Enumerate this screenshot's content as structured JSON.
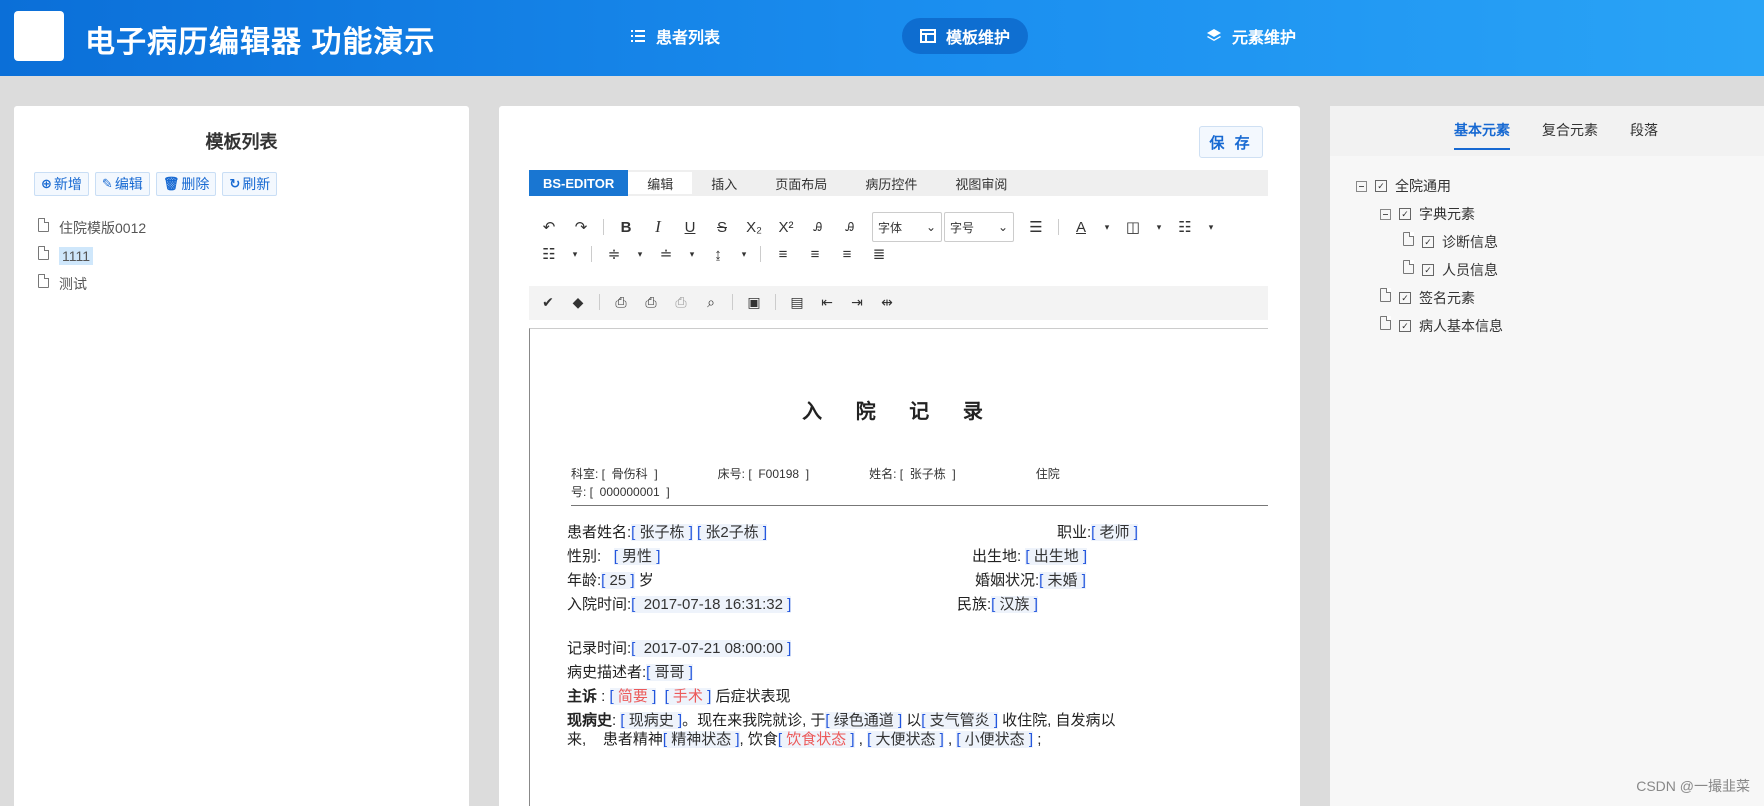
{
  "header": {
    "title": "电子病历编辑器 功能演示",
    "nav": [
      {
        "label": "患者列表",
        "icon": "list-icon"
      },
      {
        "label": "模板维护",
        "icon": "template-icon"
      },
      {
        "label": "元素维护",
        "icon": "layers-icon"
      }
    ]
  },
  "template_panel": {
    "title": "模板列表",
    "buttons": {
      "add": "新增",
      "edit": "编辑",
      "delete": "删除",
      "refresh": "刷新"
    },
    "items": [
      "住院模版0012",
      "1111",
      "测试"
    ]
  },
  "editor": {
    "save_label": "保 存",
    "brand": "BS-EDITOR",
    "tabs": [
      "编辑",
      "插入",
      "页面布局",
      "病历控件",
      "视图审阅"
    ],
    "font_select": "字体",
    "size_select": "字号",
    "document": {
      "title": "入 院 记 录",
      "info_line1": "科室: [  骨伤科  ]                  床号: [  F00198  ]                  姓名: [  张子栋  ]                        住院",
      "info_line2": "号: [  000000001  ]",
      "fields": {
        "patient_name_label": "患者姓名:",
        "patient_name_v1": "张子栋",
        "patient_name_v2": "张2子栋",
        "job_label": "职业:",
        "job_value": "老师",
        "gender_label": "性别:",
        "gender_value": "男性",
        "birthplace_label": "出生地:",
        "birthplace_value": "出生地",
        "age_label": "年龄:",
        "age_value": "25",
        "age_unit": "岁",
        "marital_label": "婚姻状况:",
        "marital_value": "未婚",
        "admit_time_label": "入院时间:",
        "admit_time_value": "2017-07-18 16:31:32",
        "ethnic_label": "民族:",
        "ethnic_value": "汉族",
        "record_time_label": "记录时间:",
        "record_time_value": "2017-07-21 08:00:00",
        "narrator_label": "病史描述者:",
        "narrator_value": "哥哥",
        "complaint_label": "主诉",
        "complaint_v1": "简要",
        "complaint_v2": "手术",
        "complaint_tail": "后症状表现",
        "hpi_label": "现病史",
        "hpi_v1": "现病史",
        "hpi_t1": "。现在来我院就诊, 于",
        "hpi_v2": "绿色通道",
        "hpi_t2": "以",
        "hpi_v3": "支气管炎",
        "hpi_t3": "收住院, 自发病以",
        "hpi_t4": "来,    患者精神",
        "hpi_v4": "精神状态",
        "hpi_t5": ", 饮食",
        "hpi_v5": "饮食状态",
        "hpi_v6": "大便状态",
        "hpi_v7": "小便状态"
      }
    }
  },
  "element_panel": {
    "tabs": [
      "基本元素",
      "复合元素",
      "段落"
    ],
    "tree": {
      "root": "全院通用",
      "dict": "字典元素",
      "dict_children": [
        "诊断信息",
        "人员信息"
      ],
      "signature": "签名元素",
      "patient_info": "病人基本信息"
    }
  },
  "watermark": "CSDN @一撮韭菜"
}
